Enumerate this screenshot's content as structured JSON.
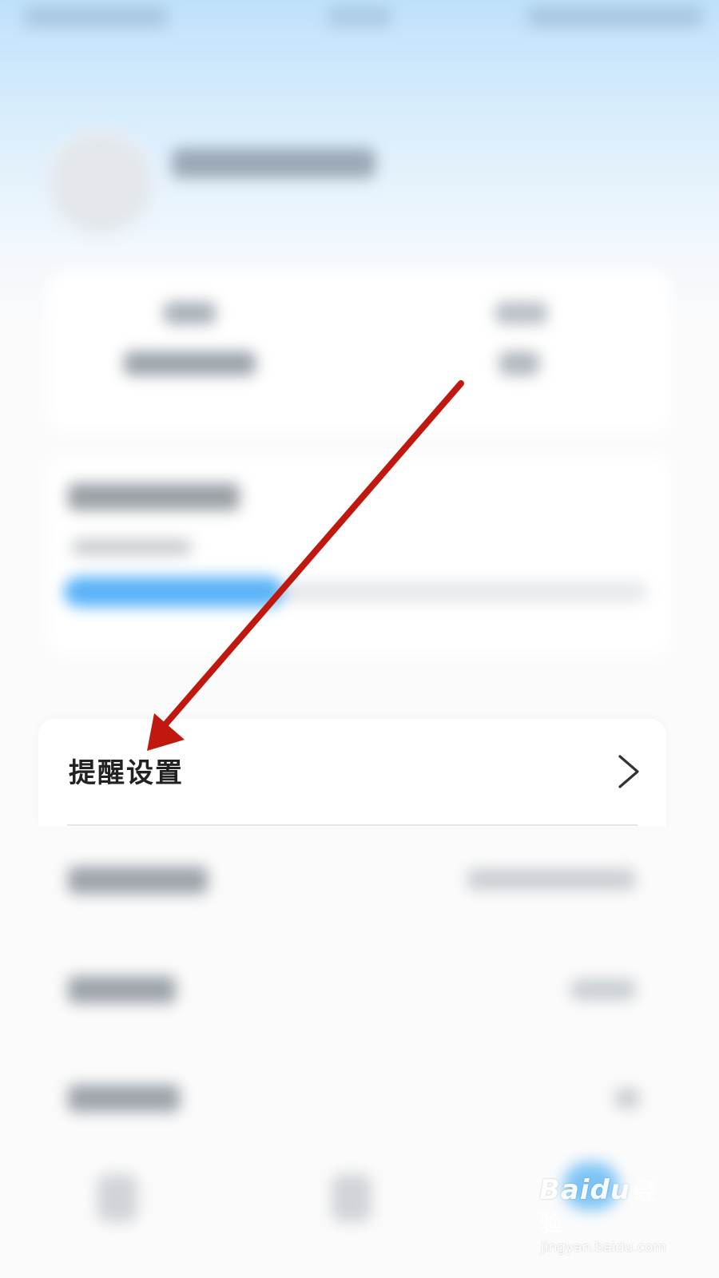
{
  "settings_row": {
    "label": "提醒设置"
  },
  "icons": {
    "chevron": "chevron-right-icon",
    "annotation_arrow": "red-arrow"
  },
  "colors": {
    "header_blue": "#bfe1fb",
    "progress_blue": "#5ab3f8",
    "annotation_red": "#c0170f"
  },
  "watermark": {
    "brand": "Baidu",
    "brand_cn": "经验",
    "url": "jingyan.baidu.com"
  }
}
